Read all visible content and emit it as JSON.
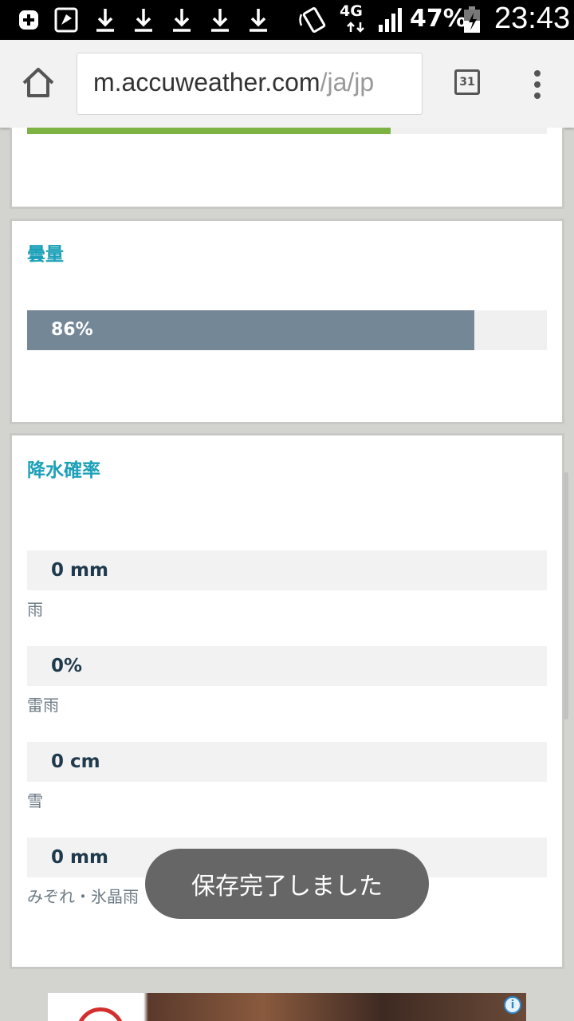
{
  "status_bar": {
    "network": "4G",
    "battery": "47%",
    "time": "23:43"
  },
  "browser": {
    "url_host": "m.accuweather.com",
    "url_path": "/ja/jp",
    "tab_count": "31"
  },
  "cloud_cover": {
    "title": "曇量",
    "value_label": "86%",
    "value": 0.86
  },
  "precipitation": {
    "title": "降水確率",
    "rows": [
      {
        "value": "0 mm",
        "label": "雨"
      },
      {
        "value": "0%",
        "label": "雷雨"
      },
      {
        "value": "0 cm",
        "label": "雪"
      },
      {
        "value": "0 mm",
        "label": "みぞれ・氷晶雨"
      }
    ]
  },
  "toast": {
    "message": "保存完了しました"
  },
  "colors": {
    "accent": "#1aa0b8",
    "bar": "#748797",
    "green_bar": "#7cb342"
  }
}
